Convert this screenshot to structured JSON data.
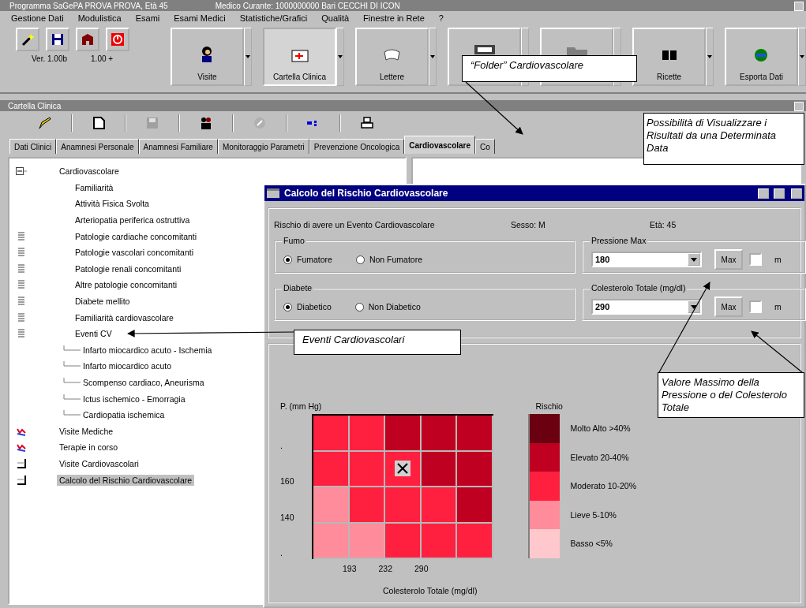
{
  "window": {
    "title": "Programma SaGePA PROVA PROVA, Età 45",
    "doctor": "Medico Curante: 1000000000 Bari CECCHI DI ICON"
  },
  "menu": [
    "Gestione Dati",
    "Modulistica",
    "Esami",
    "Esami Medici",
    "Statistiche/Grafici",
    "Qualità",
    "Finestre in Rete",
    "?"
  ],
  "toolbar": {
    "version": "Ver. 1.00b",
    "build": "1.00 +",
    "buttons": [
      {
        "label": "Visite",
        "pressed": false
      },
      {
        "label": "Cartella Clinica",
        "pressed": true
      },
      {
        "label": "Lettere",
        "pressed": false
      },
      {
        "pressed": false
      },
      {
        "pressed": false
      },
      {
        "label": "Ricette",
        "pressed": false
      },
      {
        "label": "Esporta Dati",
        "pressed": false
      }
    ]
  },
  "panel": {
    "title": "Cartella Clinica"
  },
  "tabs": [
    {
      "label": "Dati Clinici",
      "selected": false
    },
    {
      "label": "Anamnesi Personale",
      "selected": false
    },
    {
      "label": "Anamnesi Familiare",
      "selected": false
    },
    {
      "label": "Monitoraggio Parametri",
      "selected": false
    },
    {
      "label": "Prevenzione Oncologica",
      "selected": false
    },
    {
      "label": "Cardiovascolare",
      "selected": true
    },
    {
      "label": "Co",
      "selected": false
    }
  ],
  "tree": [
    {
      "label": "Cardiovascolare",
      "kind": "folder",
      "expanded": true,
      "selected": false,
      "children": [
        {
          "label": "Familiarità",
          "kind": "plain",
          "selected": false
        },
        {
          "label": "Attività Fisica Svolta",
          "kind": "plain",
          "selected": false
        },
        {
          "label": "Arteriopatia periferica ostruttiva",
          "kind": "plain",
          "selected": false
        },
        {
          "label": "Patologie cardiache concomitanti",
          "kind": "list",
          "selected": false
        },
        {
          "label": "Patologie vascolari concomitanti",
          "kind": "list",
          "selected": false
        },
        {
          "label": "Patologie renali concomitanti",
          "kind": "list",
          "selected": false
        },
        {
          "label": "Altre patologie concomitanti",
          "kind": "list",
          "selected": false
        },
        {
          "label": "Diabete mellito",
          "kind": "list",
          "selected": false
        },
        {
          "label": "Familiarità cardiovascolare",
          "kind": "list",
          "selected": false
        },
        {
          "label": "Eventi CV",
          "kind": "list",
          "expanded": true,
          "selected": false,
          "children": [
            {
              "label": "Infarto miocardico acuto - Ischemia",
              "kind": "leaf",
              "selected": false
            },
            {
              "label": "Infarto miocardico acuto",
              "kind": "leaf",
              "selected": false
            },
            {
              "label": "Scompenso cardiaco, Aneurisma",
              "kind": "leaf",
              "selected": false
            },
            {
              "label": "Ictus ischemico - Emorragia",
              "kind": "leaf",
              "selected": false
            },
            {
              "label": "Cardiopatia ischemica",
              "kind": "leaf",
              "selected": false
            }
          ]
        }
      ]
    },
    {
      "label": "Visite Mediche",
      "kind": "chart",
      "selected": false
    },
    {
      "label": "Terapie in corso",
      "kind": "chart",
      "selected": false
    },
    {
      "label": "Visite Cardiovascolari",
      "kind": "sheet",
      "selected": false
    },
    {
      "label": "Calcolo del Rischio Cardiovascolare",
      "kind": "sheet",
      "selected": true
    }
  ],
  "dialog": {
    "title": "Calcolo del Rischio Cardiovascolare",
    "info": [
      "Rischio di avere un Evento Cardiovascolare",
      "Sesso: M",
      "Età: 45"
    ],
    "groups": [
      {
        "title": "Fumo",
        "options": [
          {
            "label": "Fumatore",
            "selected": true
          },
          {
            "label": "Non Fumatore",
            "selected": false
          }
        ]
      },
      {
        "title": "Pressione Max",
        "value": "180",
        "button": "Max",
        "checked": false,
        "unit": "m"
      },
      {
        "title": "Diabete",
        "options": [
          {
            "label": "Diabetico",
            "selected": true
          },
          {
            "label": "Non Diabetico",
            "selected": false
          }
        ]
      },
      {
        "title": "Colesterolo Totale (mg/dl)",
        "value": "290",
        "button": "Max",
        "checked": false,
        "unit": "m"
      }
    ],
    "grid": {
      "ylabel": "P. (mm Hg)",
      "yticks": [
        ".",
        "160",
        "140",
        "."
      ],
      "xticks": [
        "193",
        "232",
        "290"
      ],
      "xlabel": "Colesterolo Totale (mg/dl)",
      "rows": [
        [
          {
            "color": "#ff2040",
            "marked": false
          },
          {
            "color": "#ff2040",
            "marked": false
          },
          {
            "color": "#c00020",
            "marked": false
          },
          {
            "color": "#c00020",
            "marked": false
          },
          {
            "color": "#c00020",
            "marked": false
          }
        ],
        [
          {
            "color": "#ff2040",
            "marked": false
          },
          {
            "color": "#ff2040",
            "marked": false
          },
          {
            "color": "#ff2040",
            "marked": true
          },
          {
            "color": "#c00020",
            "marked": false
          },
          {
            "color": "#c00020",
            "marked": false
          }
        ],
        [
          {
            "color": "#ff8c9a",
            "marked": false
          },
          {
            "color": "#ff2040",
            "marked": false
          },
          {
            "color": "#ff2040",
            "marked": false
          },
          {
            "color": "#ff2040",
            "marked": false
          },
          {
            "color": "#c00020",
            "marked": false
          }
        ],
        [
          {
            "color": "#ff8c9a",
            "marked": false
          },
          {
            "color": "#ff8c9a",
            "marked": false
          },
          {
            "color": "#ff2040",
            "marked": false
          },
          {
            "color": "#ff2040",
            "marked": false
          },
          {
            "color": "#ff2040",
            "marked": false
          }
        ]
      ]
    },
    "legend": {
      "title": "Rischio",
      "items": [
        {
          "label": "Molto Alto >40%",
          "color": "#6a0010"
        },
        {
          "label": "Elevato 20-40%",
          "color": "#c00020"
        },
        {
          "label": "Moderato 10-20%",
          "color": "#ff2040"
        },
        {
          "label": "Lieve 5-10%",
          "color": "#ff8c9a"
        },
        {
          "label": "Basso <5%",
          "color": "#ffc8cc"
        }
      ]
    }
  },
  "callouts": [
    {
      "text": "“Folder”  Cardiovascolare",
      "kind": "folder"
    },
    {
      "text": "Possibilità di Visualizzare i Risultati da una Determinata Data",
      "kind": "date"
    },
    {
      "text": "Eventi Cardiovascolari",
      "kind": "events"
    },
    {
      "text": "Valore Massimo della Pressione o del Colesterolo Totale",
      "kind": "max"
    }
  ]
}
